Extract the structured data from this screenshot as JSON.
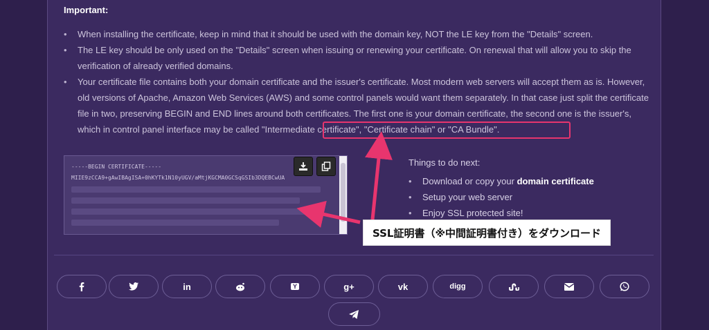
{
  "important": {
    "title": "Important:",
    "notes": [
      "When installing the certificate, keep in mind that it should be used with the domain key, NOT the LE key from the \"Details\" screen.",
      "The LE key should be only used on the \"Details\" screen when issuing or renewing your certificate. On renewal that will allow you to skip the verification of already verified domains.",
      "Your certificate file contains both your domain certificate and the issuer's certificate. Most modern web servers will accept them as is. However, old versions of Apache, Amazon Web Services (AWS) and some control panels would want them separately. In that case just split the certificate file in two, preserving BEGIN and END lines around both certificates. The first one is your domain certificate, the second one is the issuer's, which in control panel interface may be called \"Intermediate certificate\", \"Certificate chain\" or \"CA Bundle\"."
    ]
  },
  "certificate": {
    "line1": "-----BEGIN CERTIFICATE-----",
    "line2": "MIIE9zCCA9+gAwIBAgISA+0hKYTk1N10yUGV/aMtjKGCMA0GCSqGSIb3DQEBCwUA",
    "download_icon": "download-icon",
    "copy_icon": "copy-icon"
  },
  "things": {
    "title": "Things to do next:",
    "item1_prefix": "Download or copy your ",
    "item1_bold": "domain certificate",
    "item2": "Setup your web server",
    "item3": "Enjoy SSL protected site!"
  },
  "callout": {
    "text": "SSL証明書（※中間証明書付き）をダウンロード"
  },
  "share": {
    "buttons": [
      "facebook-icon",
      "twitter-icon",
      "linkedin-icon",
      "reddit-icon",
      "ycombinator-icon",
      "google-plus-icon",
      "vk-icon",
      "digg-icon",
      "stumbleupon-icon",
      "email-icon",
      "whatsapp-icon",
      "telegram-icon"
    ],
    "digg_label": "digg",
    "gplus_label": "g+",
    "li_label": "in",
    "vk_label": "vk",
    "y_label": "Y"
  },
  "colors": {
    "accent": "#e8356e",
    "background": "#2e1f4c",
    "panel": "#3b2a60"
  }
}
